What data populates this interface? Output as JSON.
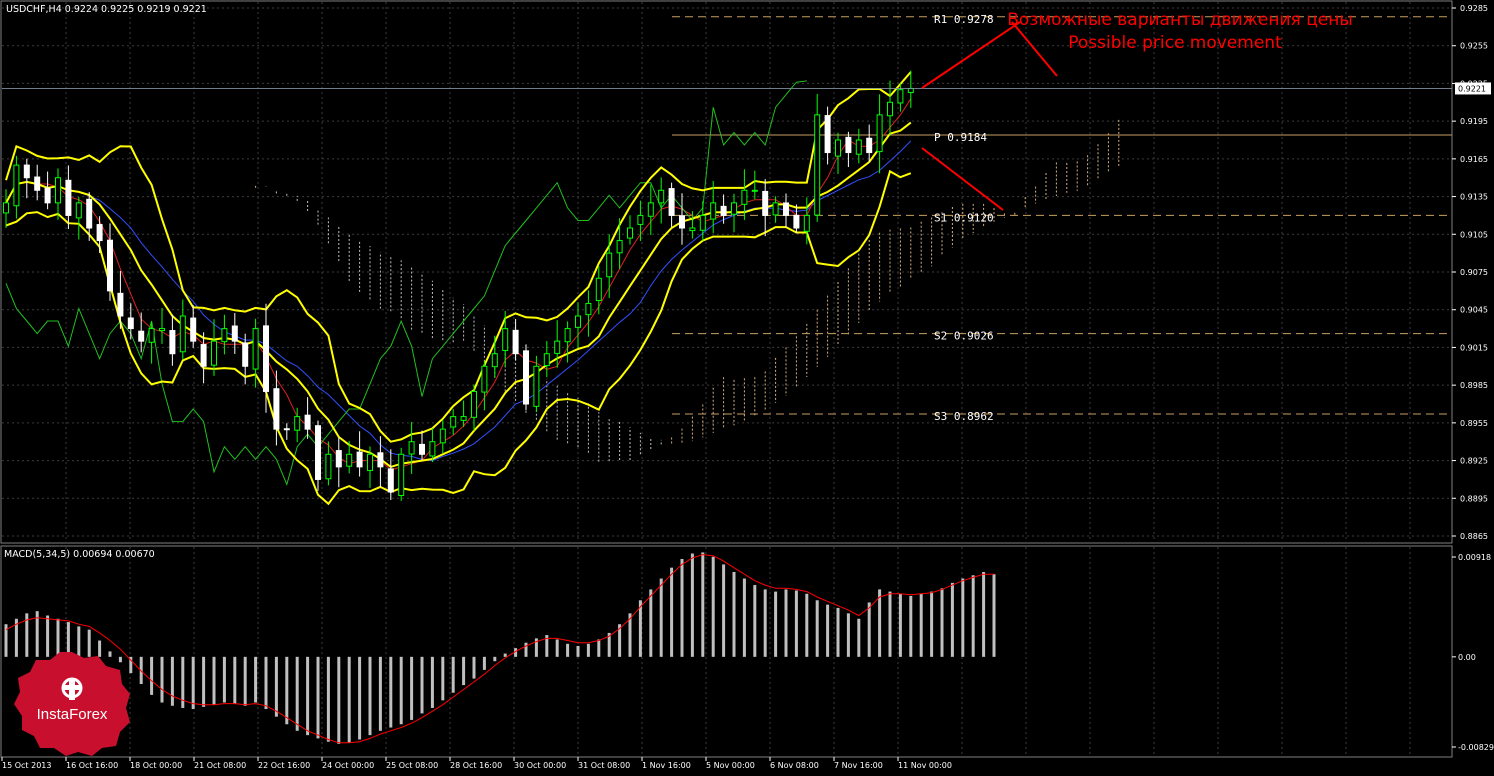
{
  "header": {
    "symbol_line": "USDCHF,H4  0.9224 0.9225 0.9219 0.9221",
    "macd_label": "MACD(5,34,5) 0.00694 0.00670"
  },
  "annotation": {
    "ru": "Возможные варианты движения цены",
    "en": "Possible price movement"
  },
  "logo": {
    "text": "InstaForex"
  },
  "colors": {
    "background": "#000000",
    "grid": "#3c3c3c",
    "bull_candle": "#00ff00",
    "bear_candle": "#ffffff",
    "bollinger": "#ffff00",
    "pivot_level": "#c8a060",
    "red_text": "#ff0000",
    "macd_hist": "#c0c0c0",
    "macd_signal": "#ff0000"
  },
  "chart_data": [
    {
      "type": "line",
      "name": "USDCHF,H4 price chart (candlesticks with Bollinger Bands, Ichimoku, pivot levels)",
      "title": "USDCHF,H4",
      "ohlc_last": {
        "open": 0.9224,
        "high": 0.9225,
        "low": 0.9219,
        "close": 0.9221
      },
      "ylim": [
        0.8865,
        0.9285
      ],
      "y_ticks": [
        "0.9285",
        "0.9255",
        "0.9225",
        "0.9195",
        "0.9165",
        "0.9135",
        "0.9105",
        "0.9075",
        "0.9045",
        "0.9015",
        "0.8985",
        "0.8955",
        "0.8925",
        "0.8895",
        "0.8865"
      ],
      "current_price": "0.9221",
      "x_ticks": [
        "15 Oct 2013",
        "16 Oct 16:00",
        "18 Oct 00:00",
        "21 Oct 08:00",
        "22 Oct 16:00",
        "24 Oct 00:00",
        "25 Oct 08:00",
        "28 Oct 16:00",
        "30 Oct 00:00",
        "31 Oct 08:00",
        "1 Nov 16:00",
        "5 Nov 00:00",
        "6 Nov 08:00",
        "7 Nov 16:00",
        "11 Nov 00:00"
      ],
      "pivot_levels": [
        {
          "label": "R1",
          "value": 0.9278,
          "text": "0.9278"
        },
        {
          "label": "P",
          "value": 0.9184,
          "text": "0.9184"
        },
        {
          "label": "S1",
          "value": 0.912,
          "text": "0.9120"
        },
        {
          "label": "S2",
          "value": 0.9026,
          "text": "0.9026"
        },
        {
          "label": "S3",
          "value": 0.8962,
          "text": "0.8962"
        }
      ],
      "closes": [
        0.913,
        0.916,
        0.915,
        0.914,
        0.913,
        0.915,
        0.912,
        0.913,
        0.911,
        0.91,
        0.906,
        0.904,
        0.903,
        0.902,
        0.903,
        0.903,
        0.901,
        0.904,
        0.902,
        0.9,
        0.902,
        0.903,
        0.902,
        0.9,
        0.903,
        0.898,
        0.895,
        0.895,
        0.896,
        0.895,
        0.891,
        0.893,
        0.892,
        0.893,
        0.892,
        0.893,
        0.892,
        0.89,
        0.893,
        0.894,
        0.893,
        0.894,
        0.895,
        0.896,
        0.896,
        0.898,
        0.9,
        0.901,
        0.903,
        0.901,
        0.897,
        0.9,
        0.901,
        0.902,
        0.903,
        0.904,
        0.905,
        0.907,
        0.909,
        0.91,
        0.911,
        0.912,
        0.913,
        0.914,
        0.912,
        0.911,
        0.911,
        0.912,
        0.913,
        0.912,
        0.913,
        0.914,
        0.914,
        0.912,
        0.913,
        0.912,
        0.911,
        0.912,
        0.92,
        0.917,
        0.918,
        0.917,
        0.918,
        0.917,
        0.92,
        0.921,
        0.922,
        0.9221
      ]
    },
    {
      "type": "bar",
      "name": "MACD(5,34,5)",
      "title": "MACD(5,34,5) 0.00694 0.00670",
      "main": 0.00694,
      "signal": 0.0067,
      "ylim": [
        -0.00829,
        0.00918
      ],
      "y_ticks": [
        "0.00918",
        "0.00",
        "-0.00829"
      ],
      "hist": [
        0.003,
        0.0035,
        0.004,
        0.0042,
        0.0038,
        0.0035,
        0.0032,
        0.0028,
        0.0025,
        0.0015,
        0.0005,
        -0.0005,
        -0.0015,
        -0.0025,
        -0.0035,
        -0.0042,
        -0.0045,
        -0.0047,
        -0.0048,
        -0.0046,
        -0.0044,
        -0.0042,
        -0.0043,
        -0.0045,
        -0.0042,
        -0.0048,
        -0.0055,
        -0.0062,
        -0.0068,
        -0.0072,
        -0.0075,
        -0.0078,
        -0.008,
        -0.0079,
        -0.0076,
        -0.0072,
        -0.0068,
        -0.0065,
        -0.0062,
        -0.0058,
        -0.0052,
        -0.0047,
        -0.004,
        -0.0033,
        -0.0026,
        -0.002,
        -0.0012,
        -0.0004,
        0.0003,
        0.0008,
        0.0013,
        0.0017,
        0.002,
        0.0016,
        0.0012,
        0.001,
        0.0012,
        0.0016,
        0.0022,
        0.003,
        0.004,
        0.0052,
        0.0062,
        0.0072,
        0.0082,
        0.009,
        0.0095,
        0.0096,
        0.0092,
        0.0085,
        0.0078,
        0.0072,
        0.0066,
        0.0062,
        0.006,
        0.0062,
        0.0061,
        0.0058,
        0.0052,
        0.0048,
        0.0045,
        0.004,
        0.0035,
        0.005,
        0.0062,
        0.006,
        0.0058,
        0.0056,
        0.0058,
        0.006,
        0.0063,
        0.0068,
        0.0072,
        0.0075,
        0.0078,
        0.0076
      ],
      "signal_line": [
        0.0025,
        0.003,
        0.0034,
        0.0036,
        0.0035,
        0.0034,
        0.0033,
        0.003,
        0.0028,
        0.0022,
        0.0015,
        0.0007,
        -0.0003,
        -0.0013,
        -0.0022,
        -0.003,
        -0.0036,
        -0.004,
        -0.0043,
        -0.0044,
        -0.0044,
        -0.0043,
        -0.0043,
        -0.0044,
        -0.0043,
        -0.0045,
        -0.005,
        -0.0056,
        -0.0062,
        -0.0068,
        -0.0072,
        -0.0076,
        -0.0079,
        -0.0079,
        -0.0078,
        -0.0075,
        -0.0071,
        -0.0068,
        -0.0065,
        -0.0061,
        -0.0056,
        -0.005,
        -0.0044,
        -0.0037,
        -0.003,
        -0.0023,
        -0.0016,
        -0.0008,
        -0.0001,
        0.0005,
        0.001,
        0.0014,
        0.0017,
        0.0017,
        0.0015,
        0.0013,
        0.0013,
        0.0015,
        0.0019,
        0.0026,
        0.0035,
        0.0046,
        0.0056,
        0.0066,
        0.0076,
        0.0085,
        0.0091,
        0.0094,
        0.0093,
        0.0088,
        0.0082,
        0.0076,
        0.007,
        0.0066,
        0.0063,
        0.0063,
        0.0062,
        0.006,
        0.0055,
        0.0051,
        0.0047,
        0.0043,
        0.0038,
        0.0045,
        0.0055,
        0.0058,
        0.0058,
        0.0057,
        0.0058,
        0.0059,
        0.0062,
        0.0066,
        0.007,
        0.0073,
        0.0076,
        0.0076
      ]
    }
  ]
}
